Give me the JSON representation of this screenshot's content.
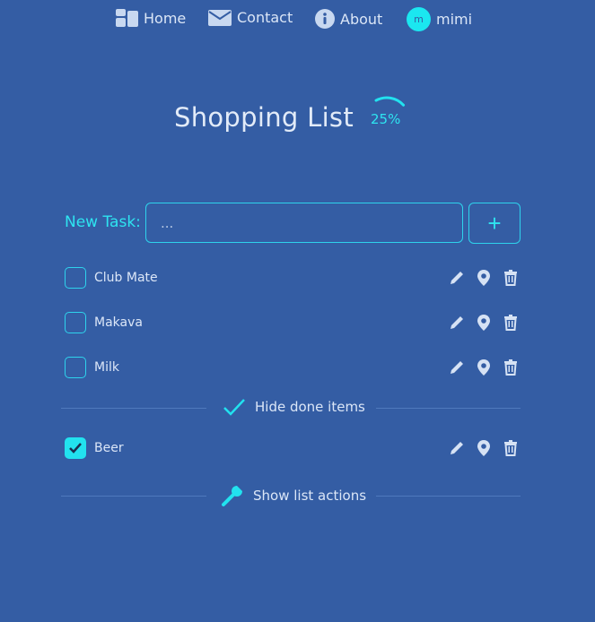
{
  "nav": {
    "home": {
      "label": "Home",
      "icon": "dashboard-icon"
    },
    "contact": {
      "label": "Contact",
      "icon": "envelope-icon"
    },
    "about": {
      "label": "About",
      "icon": "info-icon"
    },
    "user": {
      "initial": "m",
      "name": "mimi"
    }
  },
  "title": "Shopping List",
  "progress": {
    "text": "25%",
    "value": 0.25
  },
  "new_task": {
    "label": "New Task:",
    "placeholder": "...",
    "add_symbol": "+"
  },
  "items": [
    {
      "label": "Club Mate",
      "done": false
    },
    {
      "label": "Makava",
      "done": false
    },
    {
      "label": "Milk",
      "done": false
    }
  ],
  "hide_done": {
    "label": "Hide done items",
    "icon": "checkmark-icon"
  },
  "done_items": [
    {
      "label": "Beer",
      "done": true
    }
  ],
  "list_actions": {
    "label": "Show list actions",
    "icon": "wrench-icon"
  },
  "colors": {
    "background": "#345da4",
    "accent": "#22e2ef",
    "text": "#dbe6f7"
  }
}
